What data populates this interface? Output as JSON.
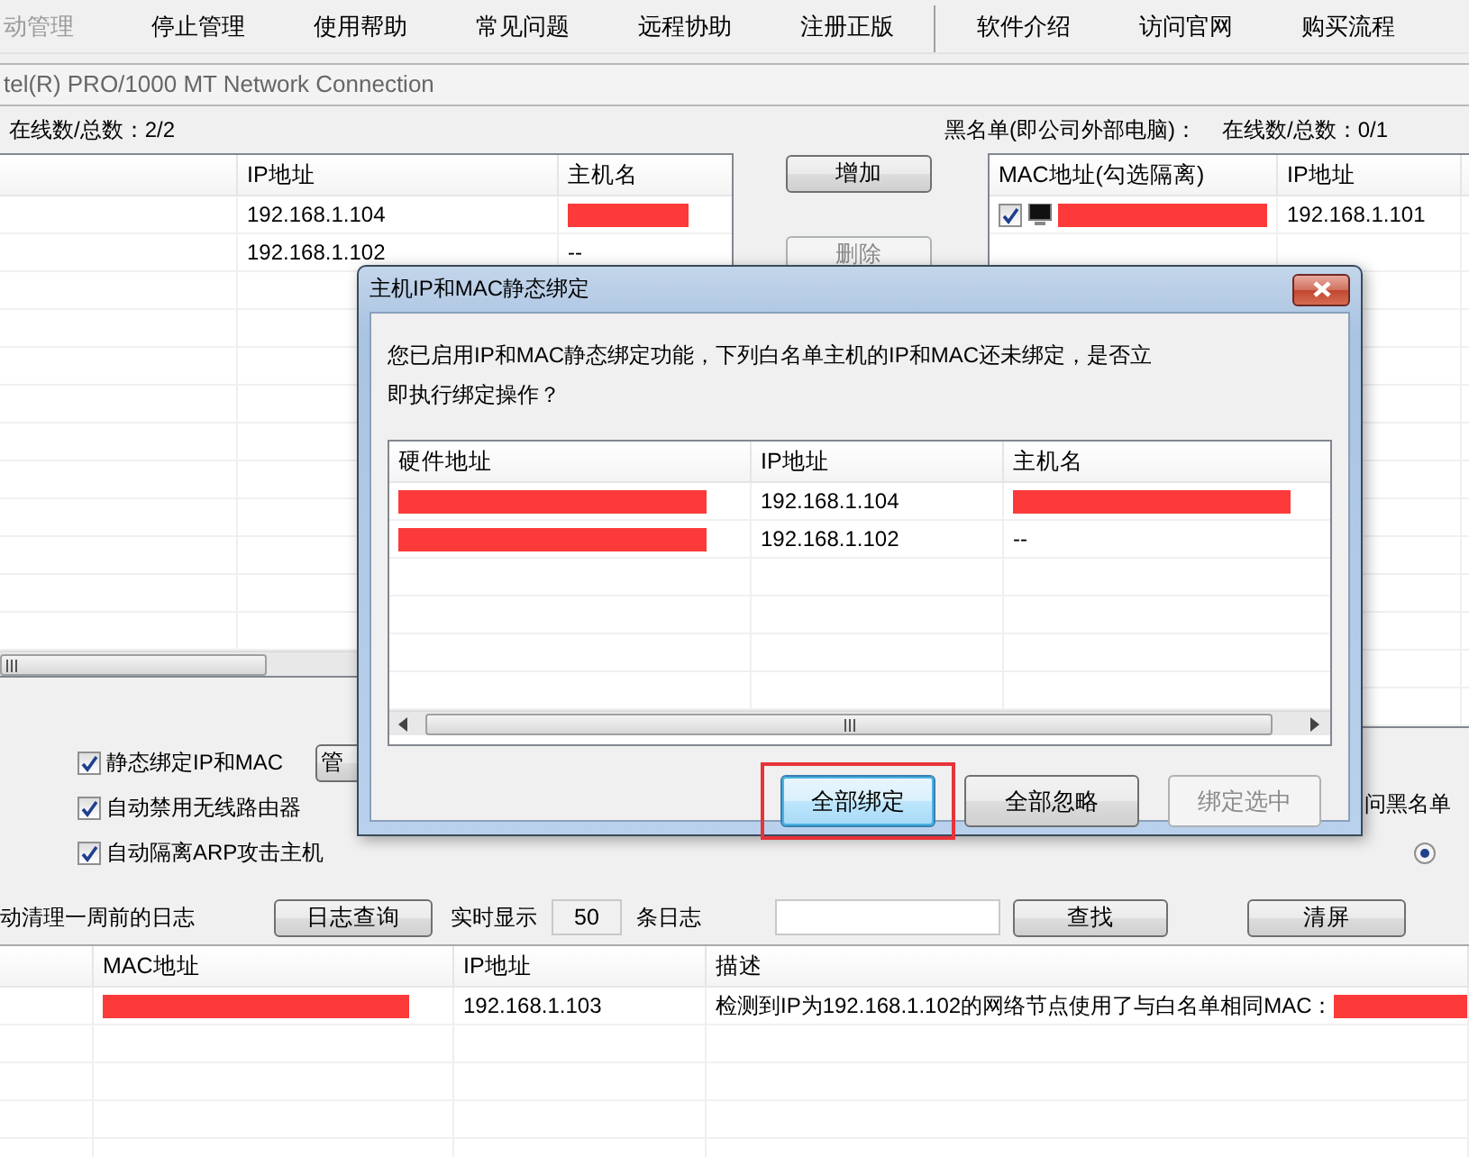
{
  "menu": [
    {
      "kind": "item",
      "label": "动管理",
      "disabled": true
    },
    {
      "kind": "item",
      "label": "停止管理",
      "disabled": false
    },
    {
      "kind": "item",
      "label": "使用帮助",
      "disabled": false
    },
    {
      "kind": "item",
      "label": "常见问题",
      "disabled": false
    },
    {
      "kind": "item",
      "label": "远程协助",
      "disabled": false
    },
    {
      "kind": "item",
      "label": "注册正版",
      "disabled": false
    },
    {
      "kind": "separator"
    },
    {
      "kind": "item",
      "label": "软件介绍",
      "disabled": false
    },
    {
      "kind": "item",
      "label": "访问官网",
      "disabled": false
    },
    {
      "kind": "item",
      "label": "购买流程",
      "disabled": false
    }
  ],
  "adapter": {
    "value": "tel(R) PRO/1000 MT Network Connection"
  },
  "whitelist": {
    "count": "在线数/总数：2/2",
    "columns": [
      {},
      {
        "label": "IP地址"
      },
      {
        "label": "主机名"
      }
    ],
    "rows": [
      [
        null,
        "192.168.1.104",
        {
          "kind": "redacted"
        }
      ],
      [
        null,
        "192.168.1.102",
        "--"
      ]
    ]
  },
  "whitelist_buttons": [
    {
      "label": "增加",
      "disabled": false
    },
    {
      "label": "删除",
      "disabled": true
    }
  ],
  "blacklist": {
    "title": "黑名单(即公司外部电脑)：",
    "count": "在线数/总数：0/1",
    "columns": [
      {
        "label": "MAC地址(勾选隔离)"
      },
      {
        "label": "IP地址"
      }
    ],
    "rows": [
      [
        {
          "kind": "device",
          "checked": true
        },
        "192.168.1.101"
      ]
    ]
  },
  "options": [
    {
      "label": "静态绑定IP和MAC",
      "checked": true
    },
    {
      "label": "自动禁用无线路由器",
      "checked": true
    },
    {
      "label": "自动隔离ARP攻击主机",
      "checked": true
    }
  ],
  "manage_button": {
    "label": "管"
  },
  "right_options": {
    "label": "问黑名单",
    "radio_selected": true
  },
  "log_toolbar": {
    "auto_clean": "动清理一周前的日志",
    "query_button": "日志查询",
    "realtime_label": "实时显示",
    "realtime_count": "50",
    "realtime_unit": "条日志",
    "find_button": "查找",
    "clear_button": "清屏"
  },
  "log_table": {
    "columns": [
      {},
      {
        "label": "MAC地址"
      },
      {
        "label": "IP地址"
      },
      {
        "label": "描述"
      }
    ],
    "rows": [
      [
        null,
        {
          "kind": "redacted"
        },
        "192.168.1.103",
        {
          "kind": "text_redacted",
          "text": "检测到IP为192.168.1.102的网络节点使用了与白名单相同MAC："
        }
      ]
    ]
  },
  "dialog": {
    "title": "主机IP和MAC静态绑定",
    "message": "您已启用IP和MAC静态绑定功能，下列白名单主机的IP和MAC还未绑定，是否立即执行绑定操作？",
    "table": {
      "columns": [
        {
          "label": "硬件地址"
        },
        {
          "label": "IP地址"
        },
        {
          "label": "主机名"
        }
      ],
      "rows": [
        [
          {
            "kind": "redacted"
          },
          "192.168.1.104",
          {
            "kind": "redacted"
          }
        ],
        [
          {
            "kind": "redacted"
          },
          "192.168.1.102",
          "--"
        ]
      ]
    },
    "buttons": [
      {
        "label": "全部绑定",
        "default": true,
        "highlighted": true,
        "disabled": false
      },
      {
        "label": "全部忽略",
        "default": false,
        "highlighted": false,
        "disabled": false
      },
      {
        "label": "绑定选中",
        "default": false,
        "highlighted": false,
        "disabled": true
      }
    ]
  }
}
